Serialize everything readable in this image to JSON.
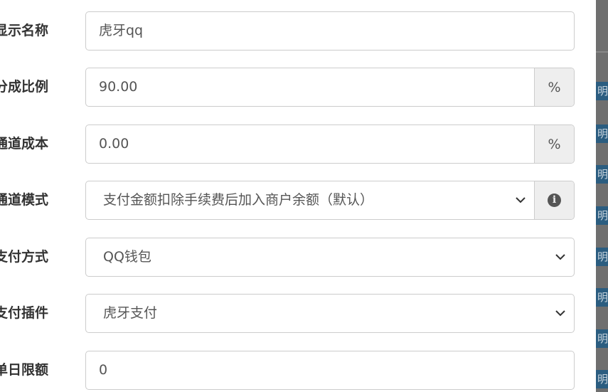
{
  "form": {
    "display_name": {
      "label": "显示名称",
      "value": "虎牙qq"
    },
    "share_ratio": {
      "label": "分成比例",
      "value": "90.00",
      "unit": "%"
    },
    "channel_cost": {
      "label": "通道成本",
      "value": "0.00",
      "unit": "%"
    },
    "channel_mode": {
      "label": "通道模式",
      "selected": "支付金额扣除手续费后加入商户余额（默认）",
      "info_icon": "info-circle-icon"
    },
    "pay_method": {
      "label": "支付方式",
      "selected": "QQ钱包"
    },
    "pay_plugin": {
      "label": "支付插件",
      "selected": "虎牙支付"
    },
    "daily_limit": {
      "label": "单日限额",
      "value": "0"
    }
  },
  "backdrop": {
    "peek_text": "明"
  }
}
